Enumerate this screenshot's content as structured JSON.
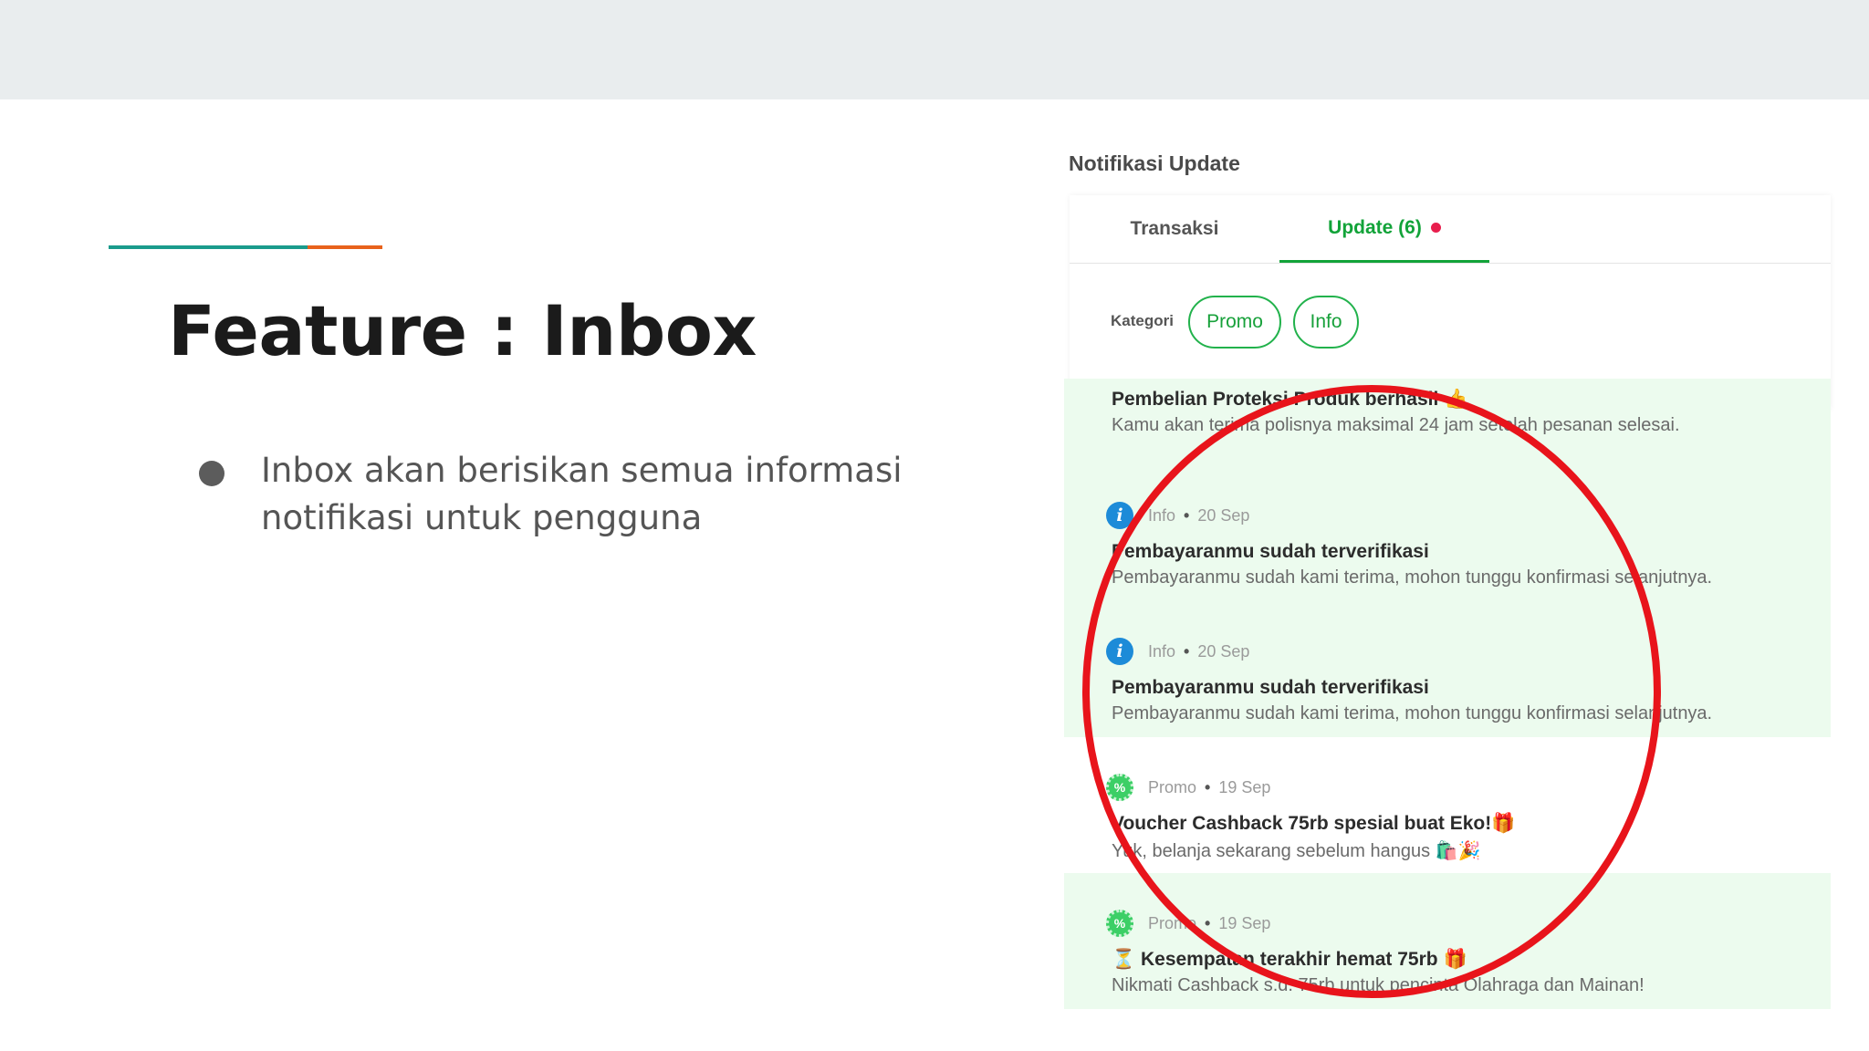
{
  "slide": {
    "title": "Feature : Inbox",
    "bullet": "Inbox akan berisikan semua informasi notifikasi untuk pengguna",
    "colors": {
      "accent_teal": "#1a9b8c",
      "accent_orange": "#e8621c",
      "highlight_circle": "#e8141b"
    }
  },
  "screenshot": {
    "header_title": "Notifikasi Update",
    "tabs": [
      {
        "label": "Transaksi",
        "active": false
      },
      {
        "label": "Update (6)",
        "active": true
      }
    ],
    "category_label": "Kategori",
    "chips": [
      "Promo",
      "Info"
    ],
    "notifications": [
      {
        "title": "Pembelian Proteksi Produk berhasil 👍",
        "body": "Kamu akan terima polisnya maksimal 24 jam setelah pesanan selesai.",
        "unread": true
      },
      {
        "category": "Info",
        "date": "20 Sep",
        "icon": "info-icon",
        "title": "Pembayaranmu sudah terverifikasi",
        "body": "Pembayaranmu sudah kami terima, mohon tunggu konfirmasi selanjutnya.",
        "unread": true
      },
      {
        "category": "Info",
        "date": "20 Sep",
        "icon": "info-icon",
        "title": "Pembayaranmu sudah terverifikasi",
        "body": "Pembayaranmu sudah kami terima, mohon tunggu konfirmasi selanjutnya.",
        "unread": true
      },
      {
        "category": "Promo",
        "date": "19 Sep",
        "icon": "promo-badge-icon",
        "title": "Voucher Cashback 75rb spesial buat Eko!🎁",
        "body": "Yuk, belanja sekarang sebelum hangus 🛍️🎉",
        "unread": false
      },
      {
        "category": "Promo",
        "date": "19 Sep",
        "icon": "promo-badge-icon",
        "title": "⏳ Kesempatan terakhir hemat 75rb 🎁",
        "body": "Nikmati Cashback s.d. 75rb untuk pencinta Olahraga dan Mainan!",
        "unread": true
      }
    ]
  }
}
